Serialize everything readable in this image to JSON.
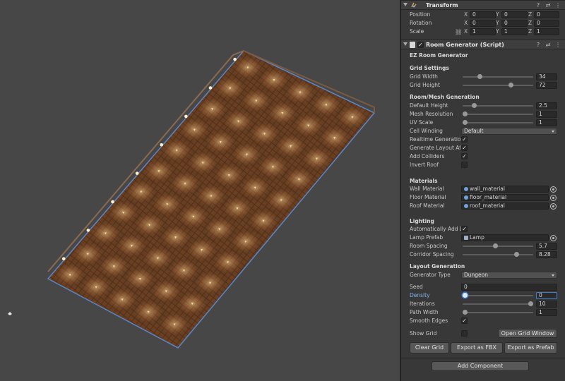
{
  "transform": {
    "title": "Transform",
    "position": {
      "label": "Position",
      "x": "0",
      "y": "0",
      "z": "0"
    },
    "rotation": {
      "label": "Rotation",
      "x": "0",
      "y": "0",
      "z": "0"
    },
    "scale": {
      "label": "Scale",
      "x": "1",
      "y": "1",
      "z": "1"
    },
    "axes": {
      "x": "X",
      "y": "Y",
      "z": "Z"
    }
  },
  "room_generator": {
    "title": "Room Generator (Script)",
    "heading": "EZ Room Generator",
    "grid_settings": {
      "section": "Grid Settings",
      "grid_width": {
        "label": "Grid Width",
        "value": "34",
        "fraction": 0.23
      },
      "grid_height": {
        "label": "Grid Height",
        "value": "72",
        "fraction": 0.7
      }
    },
    "mesh": {
      "section": "Room/Mesh Generation",
      "default_height": {
        "label": "Default Height",
        "value": "2.5",
        "fraction": 0.14
      },
      "mesh_resolution": {
        "label": "Mesh Resolution",
        "value": "1",
        "fraction": 0.0
      },
      "uv_scale": {
        "label": "UV Scale",
        "value": "1",
        "fraction": 0.0
      },
      "cell_winding": {
        "label": "Cell Winding",
        "value": "Default"
      },
      "realtime_generation": {
        "label": "Realtime Generation",
        "checked": true
      },
      "generate_layout": {
        "label": "Generate Layout Afte",
        "checked": true
      },
      "add_colliders": {
        "label": "Add Colliders",
        "checked": true
      },
      "invert_roof": {
        "label": "Invert Roof",
        "checked": false
      }
    },
    "materials": {
      "section": "Materials",
      "wall": {
        "label": "Wall Material",
        "value": "wall_material"
      },
      "floor": {
        "label": "Floor Material",
        "value": "floor_material"
      },
      "roof": {
        "label": "Roof Material",
        "value": "roof_material"
      }
    },
    "lighting": {
      "section": "Lighting",
      "auto_add_lights": {
        "label": "Automatically Add Li",
        "checked": true
      },
      "lamp_prefab": {
        "label": "Lamp Prefab",
        "value": "Lamp"
      },
      "room_spacing": {
        "label": "Room Spacing",
        "value": "5.7",
        "fraction": 0.46
      },
      "corridor_spacing": {
        "label": "Corridor Spacing",
        "value": "8.28",
        "fraction": 0.78
      }
    },
    "layout": {
      "section": "Layout Generation",
      "generator_type": {
        "label": "Generator Type",
        "value": "Dungeon"
      },
      "seed": {
        "label": "Seed",
        "value": "0"
      },
      "density": {
        "label": "Density",
        "value": "0",
        "fraction": 0.0
      },
      "iterations": {
        "label": "Iterations",
        "value": "10",
        "fraction": 1.0
      },
      "path_width": {
        "label": "Path Width",
        "value": "1",
        "fraction": 0.0
      },
      "smooth_edges": {
        "label": "Smooth Edges",
        "checked": true
      },
      "show_grid": {
        "label": "Show Grid",
        "checked": false
      },
      "open_grid_window": "Open Grid Window"
    },
    "buttons": {
      "clear_grid": "Clear Grid",
      "export_fbx": "Export as FBX",
      "export_prefab": "Export as Prefab"
    }
  },
  "add_component": "Add Component",
  "icons": {
    "help": "help-icon",
    "preset": "preset-icon",
    "menu": "menu-icon",
    "link": "link-icon",
    "object_picker": "object-picker-icon"
  },
  "colors": {
    "accent": "#3f7fd3",
    "floor": "#6e4226",
    "outline": "#5a86c9",
    "light": "#ffd68a"
  }
}
